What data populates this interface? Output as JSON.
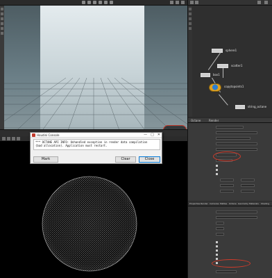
{
  "viewport": {
    "icons": [
      "select-tool-icon",
      "transform-icon",
      "rotate-icon",
      "scale-icon",
      "pose-icon",
      "handle-icon"
    ],
    "bottom_label": "",
    "stats_lines": [
      "",
      "",
      ""
    ]
  },
  "console": {
    "title": "Houdini Console",
    "message_line1": "*** OCTANE API INFO: Unhandled exception in render data compilation",
    "message_line2": "(bad allocation). Application must restart.",
    "buttons": {
      "mark": "Mark",
      "clear": "Clear",
      "close": "Close"
    },
    "title_controls": [
      "—",
      "□",
      "✕"
    ]
  },
  "network": {
    "nodes": [
      {
        "name": "sphere1"
      },
      {
        "name": "scatter1"
      },
      {
        "name": "box1"
      },
      {
        "name": "copytopoints1"
      },
      {
        "name": "string_octane"
      }
    ]
  },
  "parameters": {
    "tabs": [
      "Octane",
      "Render"
    ],
    "section_tabs": [
      "Properties",
      "Render",
      "Cameras",
      "Mattes",
      "Octane",
      "Geometry",
      "Materials",
      "Shading"
    ]
  },
  "colors": {
    "highlight_ring": "#d23a2a",
    "node_orange": "#e0a020",
    "node_blue": "#2d7fd0"
  }
}
